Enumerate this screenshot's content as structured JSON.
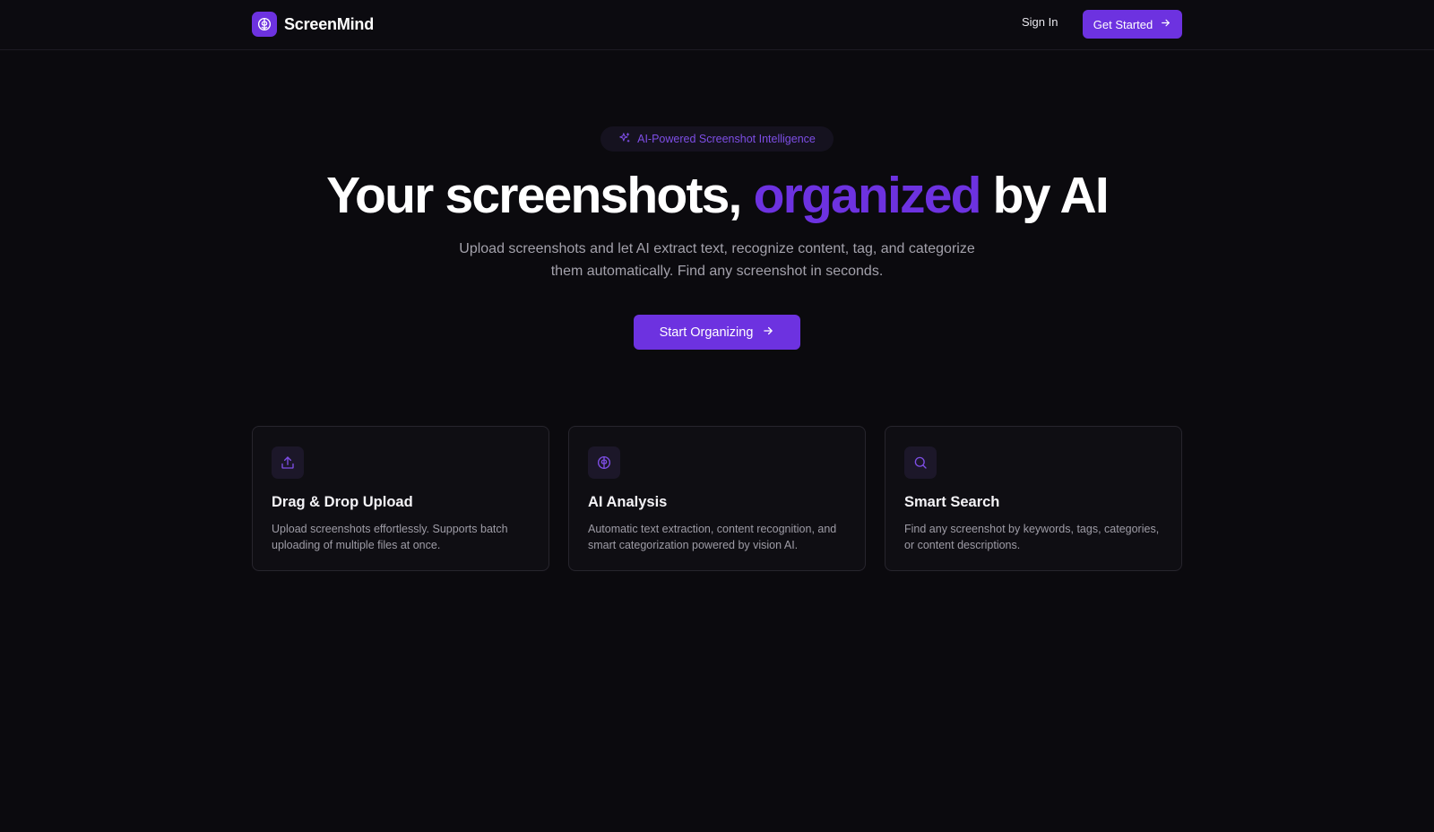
{
  "colors": {
    "background": "#0b0a0e",
    "accent": "#6d32e0",
    "card_border": "#27252d",
    "muted_text": "#a3a1ab"
  },
  "header": {
    "brand_name": "ScreenMind",
    "brand_icon": "brain-icon",
    "sign_in_label": "Sign In",
    "get_started_label": "Get Started",
    "get_started_icon": "arrow-right-icon"
  },
  "hero": {
    "badge_icon": "sparkles-icon",
    "badge_text": "AI-Powered Screenshot Intelligence",
    "title_before": "Your screenshots,",
    "title_accent": "organized",
    "title_after": "by AI",
    "subtitle": "Upload screenshots and let AI extract text, recognize content, tag, and categorize them automatically. Find any screenshot in seconds.",
    "cta_label": "Start Organizing",
    "cta_icon": "arrow-right-icon"
  },
  "features": [
    {
      "icon": "upload-icon",
      "title": "Drag & Drop Upload",
      "description": "Upload screenshots effortlessly. Supports batch uploading of multiple files at once."
    },
    {
      "icon": "brain-icon",
      "title": "AI Analysis",
      "description": "Automatic text extraction, content recognition, and smart categorization powered by vision AI."
    },
    {
      "icon": "search-icon",
      "title": "Smart Search",
      "description": "Find any screenshot by keywords, tags, categories, or content descriptions."
    }
  ]
}
